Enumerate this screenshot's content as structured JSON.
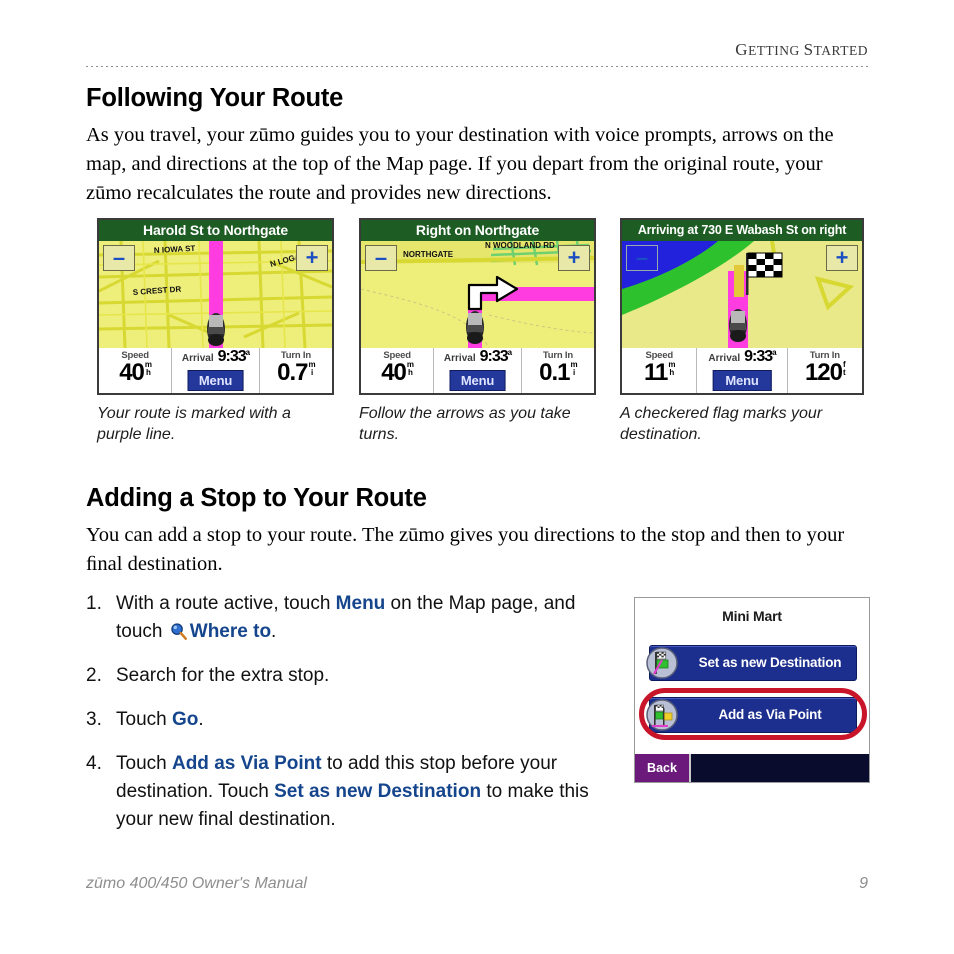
{
  "header": {
    "running_head_large": "G",
    "running_head_rest": "ETTING ",
    "running_head_large2": "S",
    "running_head_rest2": "TARTED"
  },
  "sections": [
    {
      "heading": "Following Your Route",
      "body": "As you travel, your zūmo guides you to your destination with voice prompts, arrows on the map, and directions at the top of the Map page. If you depart from the original route, your zūmo recalculates the route and provides new directions."
    },
    {
      "heading": "Adding a Stop to Your Route",
      "body": "You can add a stop to your route. The zūmo gives you directions to the stop and then to your ﬁnal destination."
    }
  ],
  "figures": [
    {
      "title": "Harold St to Northgate",
      "speed_label": "Speed",
      "speed_value": "40",
      "speed_unit_top": "m",
      "speed_unit_bottom": "h",
      "arrival_label": "Arrival",
      "arrival_value": "9:33",
      "arrival_ampm": "a",
      "menu_label": "Menu",
      "turn_label": "Turn In",
      "turn_value": "0.7",
      "turn_unit_top": "m",
      "turn_unit_bottom": "i",
      "zoom_out": "–",
      "zoom_in": "+",
      "street_labels": [
        "N IOWA ST",
        "N LOGAN ST",
        "S CREST DR"
      ],
      "caption": "Your route is marked with a purple line."
    },
    {
      "title": "Right on Northgate",
      "speed_label": "Speed",
      "speed_value": "40",
      "speed_unit_top": "m",
      "speed_unit_bottom": "h",
      "arrival_label": "Arrival",
      "arrival_value": "9:33",
      "arrival_ampm": "a",
      "menu_label": "Menu",
      "turn_label": "Turn In",
      "turn_value": "0.1",
      "turn_unit_top": "m",
      "turn_unit_bottom": "i",
      "zoom_out": "–",
      "zoom_in": "+",
      "street_labels": [
        "NORTHGATE",
        "N WOODLAND RD"
      ],
      "caption": "Follow the arrows as you take turns."
    },
    {
      "title": "Arriving at 730 E Wabash St on right",
      "speed_label": "Speed",
      "speed_value": "11",
      "speed_unit_top": "m",
      "speed_unit_bottom": "h",
      "arrival_label": "Arrival",
      "arrival_value": "9:33",
      "arrival_ampm": "a",
      "menu_label": "Menu",
      "turn_label": "Turn In",
      "turn_value": "120",
      "turn_unit_top": "f",
      "turn_unit_bottom": "t",
      "zoom_out": "–",
      "zoom_in": "+",
      "street_labels": [],
      "caption": "A checkered flag marks your destination."
    }
  ],
  "steps": [
    {
      "num": "1.",
      "parts": [
        {
          "t": "With a route active, touch ",
          "s": "plain"
        },
        {
          "t": "Menu",
          "s": "ui"
        },
        {
          "t": " on the Map page, and touch ",
          "s": "plain"
        },
        {
          "t": "search-icon",
          "s": "icon"
        },
        {
          "t": "Where to",
          "s": "ui"
        },
        {
          "t": ".",
          "s": "plain"
        }
      ]
    },
    {
      "num": "2.",
      "parts": [
        {
          "t": "Search for the extra stop.",
          "s": "plain"
        }
      ]
    },
    {
      "num": "3.",
      "parts": [
        {
          "t": "Touch ",
          "s": "plain"
        },
        {
          "t": "Go",
          "s": "ui"
        },
        {
          "t": ".",
          "s": "plain"
        }
      ]
    },
    {
      "num": "4.",
      "parts": [
        {
          "t": "Touch ",
          "s": "plain"
        },
        {
          "t": "Add as Via Point",
          "s": "ui"
        },
        {
          "t": " to add this stop before your destination. Touch ",
          "s": "plain"
        },
        {
          "t": "Set as new Destination",
          "s": "ui"
        },
        {
          "t": " to make this your new final destination.",
          "s": "plain"
        }
      ]
    }
  ],
  "mini_mart": {
    "title": "Mini Mart",
    "buttons": [
      {
        "label": "Set as new Destination",
        "icon": "destination-flag-icon",
        "highlighted": false
      },
      {
        "label": "Add as Via Point",
        "icon": "via-point-flag-icon",
        "highlighted": true
      }
    ],
    "back_label": "Back"
  },
  "footer": {
    "left": "zūmo 400/450 Owner's Manual",
    "page": "9"
  },
  "colors": {
    "ui_term": "#15458c",
    "title_bar_green": "#1d5c22",
    "route_magenta": "#ff3ce0",
    "map_yellow": "#eeee7b",
    "highlight_red": "#c8152a",
    "device_blue": "#1d2f8e",
    "back_purple": "#6b1a7c"
  }
}
